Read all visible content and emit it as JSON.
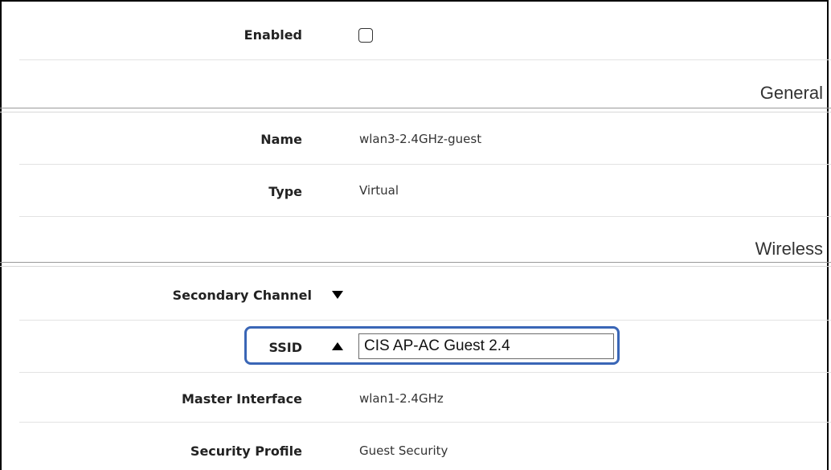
{
  "fields": {
    "enabled": {
      "label": "Enabled",
      "checked": false
    },
    "name": {
      "label": "Name",
      "value": "wlan3-2.4GHz-guest"
    },
    "type": {
      "label": "Type",
      "value": "Virtual"
    },
    "secondary_channel": {
      "label": "Secondary Channel"
    },
    "ssid": {
      "label": "SSID",
      "value": "CIS AP-AC Guest 2.4"
    },
    "master_interface": {
      "label": "Master Interface",
      "value": "wlan1-2.4GHz"
    },
    "security_profile": {
      "label": "Security Profile",
      "value": "Guest Security"
    }
  },
  "sections": {
    "general": "General",
    "wireless": "Wireless"
  },
  "colors": {
    "highlight": "#3a66b6",
    "label_text": "#222222",
    "value_text": "#333333"
  }
}
